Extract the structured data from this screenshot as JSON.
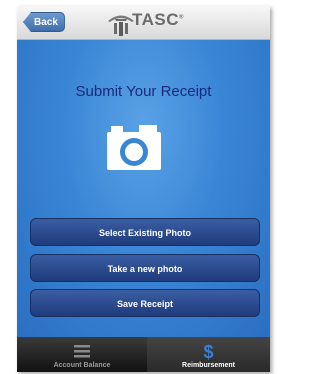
{
  "navbar": {
    "back_label": "Back",
    "logo_text": "TASC",
    "logo_mark": "®"
  },
  "main": {
    "title": "Submit Your Receipt",
    "camera_icon": "camera-icon",
    "buttons": [
      {
        "label": "Select Existing Photo"
      },
      {
        "label": "Take a new photo"
      },
      {
        "label": "Save Receipt"
      }
    ]
  },
  "tabbar": {
    "tabs": [
      {
        "label": "Account Balance",
        "icon": "list-icon",
        "selected": false
      },
      {
        "label": "Reimbursement",
        "icon": "dollar-icon",
        "selected": true
      }
    ]
  },
  "colors": {
    "background_blue": "#3a86d6",
    "button_navy": "#24417f",
    "title_navy": "#1a2a7a",
    "reimbursement_icon": "#3a7fd0"
  }
}
